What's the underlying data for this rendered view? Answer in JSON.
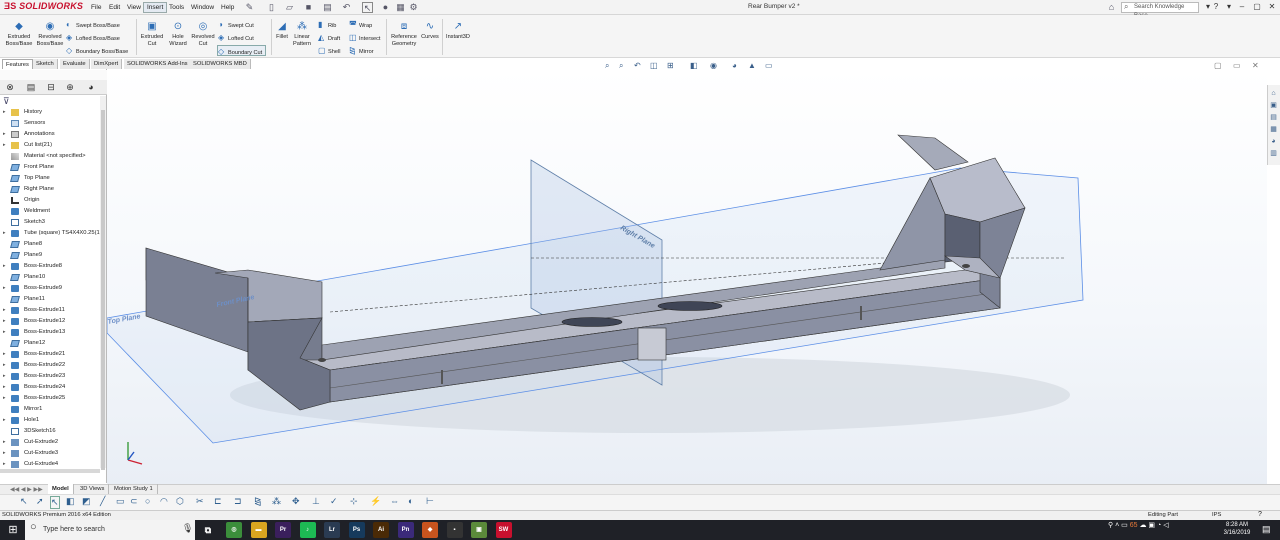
{
  "app": {
    "name": "SOLIDWORKS",
    "doc_title": "Rear Bumper v2 *",
    "search_placeholder": "Search Knowledge Base"
  },
  "menu": [
    "File",
    "Edit",
    "View",
    "Insert",
    "Tools",
    "Window",
    "Help"
  ],
  "commands": {
    "extruded_boss": "Extruded\nBoss/Base",
    "revolved_boss": "Revolved\nBoss/Base",
    "swept_boss": "Swept Boss/Base",
    "lofted_boss": "Lofted Boss/Base",
    "boundary_boss": "Boundary Boss/Base",
    "extruded_cut": "Extruded\nCut",
    "hole_wizard": "Hole\nWizard",
    "revolved_cut": "Revolved\nCut",
    "swept_cut": "Swept Cut",
    "lofted_cut": "Lofted Cut",
    "boundary_cut": "Boundary Cut",
    "fillet": "Fillet",
    "linear_pattern": "Linear\nPattern",
    "rib": "Rib",
    "draft": "Draft",
    "shell": "Shell",
    "wrap": "Wrap",
    "intersect": "Intersect",
    "mirror": "Mirror",
    "reference_geometry": "Reference\nGeometry",
    "curves": "Curves",
    "instant3d": "Instant3D"
  },
  "tabs": [
    "Features",
    "Sketch",
    "Evaluate",
    "DimXpert",
    "SOLIDWORKS Add-Ins",
    "SOLIDWORKS MBD"
  ],
  "tree": [
    {
      "label": "History",
      "type": "folder",
      "arrow": true
    },
    {
      "label": "Sensors",
      "type": "sensor",
      "arrow": false
    },
    {
      "label": "Annotations",
      "type": "ann",
      "arrow": true
    },
    {
      "label": "Cut list(21)",
      "type": "folder",
      "arrow": true
    },
    {
      "label": "Material <not specified>",
      "type": "mat",
      "arrow": false
    },
    {
      "label": "Front Plane",
      "type": "plane",
      "arrow": false
    },
    {
      "label": "Top Plane",
      "type": "plane",
      "arrow": false
    },
    {
      "label": "Right Plane",
      "type": "plane",
      "arrow": false
    },
    {
      "label": "Origin",
      "type": "origin",
      "arrow": false
    },
    {
      "label": "Weldment",
      "type": "feat",
      "arrow": false
    },
    {
      "label": "Sketch3",
      "type": "sketch",
      "arrow": false
    },
    {
      "label": "Tube (square) TS4X4X0.25(1)",
      "type": "feat",
      "arrow": true
    },
    {
      "label": "Plane8",
      "type": "plane",
      "arrow": false
    },
    {
      "label": "Plane9",
      "type": "plane",
      "arrow": false
    },
    {
      "label": "Boss-Extrude8",
      "type": "feat",
      "arrow": true
    },
    {
      "label": "Plane10",
      "type": "plane",
      "arrow": false
    },
    {
      "label": "Boss-Extrude9",
      "type": "feat",
      "arrow": true
    },
    {
      "label": "Plane11",
      "type": "plane",
      "arrow": false
    },
    {
      "label": "Boss-Extrude11",
      "type": "feat",
      "arrow": true
    },
    {
      "label": "Boss-Extrude12",
      "type": "feat",
      "arrow": true
    },
    {
      "label": "Boss-Extrude13",
      "type": "feat",
      "arrow": true
    },
    {
      "label": "Plane12",
      "type": "plane",
      "arrow": false
    },
    {
      "label": "Boss-Extrude21",
      "type": "feat",
      "arrow": true
    },
    {
      "label": "Boss-Extrude22",
      "type": "feat",
      "arrow": true
    },
    {
      "label": "Boss-Extrude23",
      "type": "feat",
      "arrow": true
    },
    {
      "label": "Boss-Extrude24",
      "type": "feat",
      "arrow": true
    },
    {
      "label": "Boss-Extrude25",
      "type": "feat",
      "arrow": true
    },
    {
      "label": "Mirror1",
      "type": "feat",
      "arrow": false
    },
    {
      "label": "Hole1",
      "type": "feat",
      "arrow": true
    },
    {
      "label": "3DSketch16",
      "type": "sketch",
      "arrow": false
    },
    {
      "label": "Cut-Extrude2",
      "type": "cut",
      "arrow": true
    },
    {
      "label": "Cut-Extrude3",
      "type": "cut",
      "arrow": true
    },
    {
      "label": "Cut-Extrude4",
      "type": "cut",
      "arrow": true
    }
  ],
  "viewport_labels": {
    "front_plane": "Front Plane",
    "top_plane": "Top Plane",
    "right_plane": "Right Plane"
  },
  "bottom_tabs": [
    "Model",
    "3D Views",
    "Motion Study 1"
  ],
  "status": {
    "edition": "SOLIDWORKS Premium 2016 x64 Edition",
    "mode": "Editing Part",
    "units": "IPS"
  },
  "taskbar": {
    "search_placeholder": "Type here to search",
    "time": "8:28 AM",
    "date": "3/16/2019",
    "apps": [
      {
        "name": "Chrome",
        "abbr": "◎",
        "color": "#3b8e3b"
      },
      {
        "name": "File Explorer",
        "abbr": "▬",
        "color": "#d9a520"
      },
      {
        "name": "Premiere",
        "abbr": "Pr",
        "color": "#3a1f5c"
      },
      {
        "name": "Spotify",
        "abbr": "♪",
        "color": "#1db954"
      },
      {
        "name": "Lightroom",
        "abbr": "Lr",
        "color": "#2a3b52"
      },
      {
        "name": "Photoshop",
        "abbr": "Ps",
        "color": "#163a5c"
      },
      {
        "name": "Illustrator",
        "abbr": "Ai",
        "color": "#4a2a06"
      },
      {
        "name": "Premiere Rush",
        "abbr": "Pn",
        "color": "#3b2a7a"
      },
      {
        "name": "Fusion",
        "abbr": "◆",
        "color": "#c8541e"
      },
      {
        "name": "App",
        "abbr": "▪",
        "color": "#333333"
      },
      {
        "name": "Minecraft",
        "abbr": "▣",
        "color": "#5b8a3a"
      },
      {
        "name": "SOLIDWORKS",
        "abbr": "SW",
        "color": "#c8102e"
      }
    ],
    "tray_temp": "65"
  }
}
